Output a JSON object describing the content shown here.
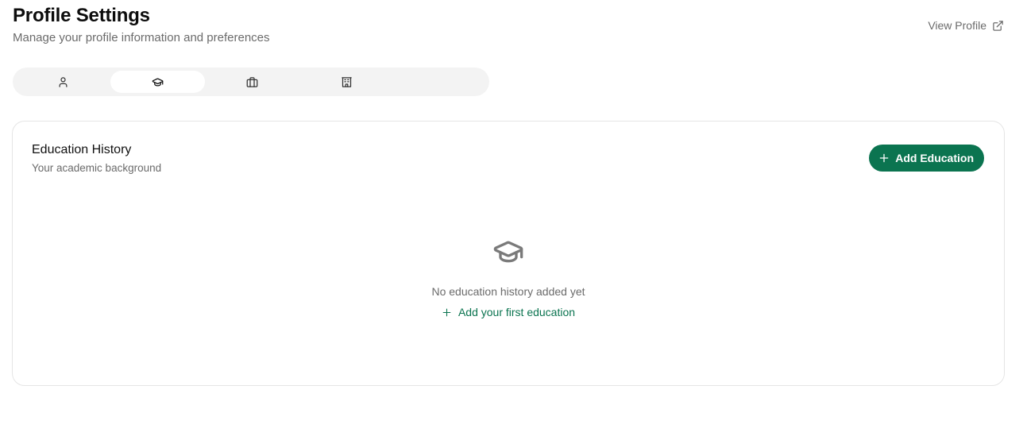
{
  "header": {
    "title": "Profile Settings",
    "subtitle": "Manage your profile information and preferences",
    "view_profile_label": "View Profile"
  },
  "tabs": [
    {
      "icon": "user-icon",
      "active": false
    },
    {
      "icon": "graduation-cap-icon",
      "active": true
    },
    {
      "icon": "briefcase-icon",
      "active": false
    },
    {
      "icon": "building-icon",
      "active": false
    }
  ],
  "education": {
    "title": "Education History",
    "subtitle": "Your academic background",
    "add_button_label": "Add Education",
    "empty_icon": "graduation-cap-icon",
    "empty_text": "No education history added yet",
    "empty_link_label": "Add your first education"
  },
  "colors": {
    "accent": "#0b7450",
    "muted_text": "#6b6b6b",
    "tab_bar_bg": "#f3f3f3"
  }
}
